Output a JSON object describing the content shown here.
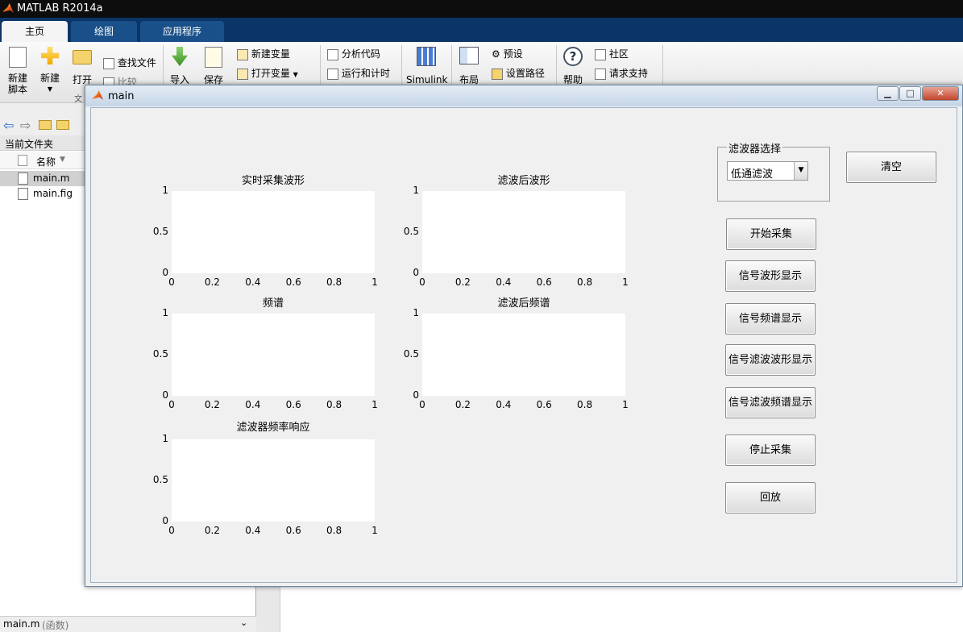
{
  "app": {
    "title": "MATLAB R2014a"
  },
  "tabs": [
    {
      "label": "主页"
    },
    {
      "label": "绘图"
    },
    {
      "label": "应用程序"
    }
  ],
  "ribbon": {
    "new_script": "新建\n脚本",
    "new": "新建",
    "open": "打开",
    "find_files": "查找文件",
    "compare": "比较",
    "import": "导入",
    "save": "保存",
    "new_variable": "新建变量",
    "open_variable": "打开变量",
    "analyze_code": "分析代码",
    "run_time": "运行和计时",
    "simulink": "Simulink",
    "layout": "布局",
    "preferences": "预设",
    "set_path": "设置路径",
    "help": "帮助",
    "community": "社区",
    "request_support": "请求支持",
    "group_file": "文"
  },
  "left_pane": {
    "title": "当前文件夹",
    "column_name": "名称",
    "files": [
      {
        "name": "main.m"
      },
      {
        "name": "main.fig"
      }
    ],
    "footer_name": "main.m",
    "footer_type": "(函数)"
  },
  "figure": {
    "title": "main",
    "axes": [
      {
        "title": "实时采集波形",
        "xticks": [
          "0",
          "0.2",
          "0.4",
          "0.6",
          "0.8",
          "1"
        ],
        "yticks": [
          "1",
          "0.5",
          "0"
        ]
      },
      {
        "title": "滤波后波形",
        "xticks": [
          "0",
          "0.2",
          "0.4",
          "0.6",
          "0.8",
          "1"
        ],
        "yticks": [
          "1",
          "0.5",
          "0"
        ]
      },
      {
        "title": "频谱",
        "xticks": [
          "0",
          "0.2",
          "0.4",
          "0.6",
          "0.8",
          "1"
        ],
        "yticks": [
          "1",
          "0.5",
          "0"
        ]
      },
      {
        "title": "滤波后频谱",
        "xticks": [
          "0",
          "0.2",
          "0.4",
          "0.6",
          "0.8",
          "1"
        ],
        "yticks": [
          "1",
          "0.5",
          "0"
        ]
      },
      {
        "title": "滤波器频率响应",
        "xticks": [
          "0",
          "0.2",
          "0.4",
          "0.6",
          "0.8",
          "1"
        ],
        "yticks": [
          "1",
          "0.5",
          "0"
        ]
      }
    ],
    "filter_group": {
      "label": "滤波器选择",
      "selected": "低通滤波"
    },
    "buttons": {
      "clear": "清空",
      "start": "开始采集",
      "signal_wave": "信号波形显示",
      "signal_spectrum": "信号频谱显示",
      "filtered_wave": "信号滤波波形显示",
      "filtered_spectrum": "信号滤波频谱显示",
      "stop": "停止采集",
      "playback": "回放"
    }
  }
}
